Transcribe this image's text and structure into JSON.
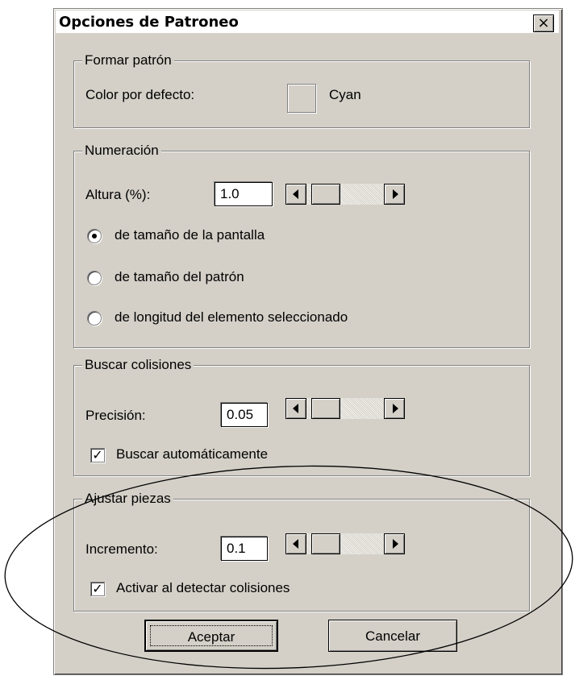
{
  "dialog": {
    "title": "Opciones de Patroneo",
    "close_label": "×"
  },
  "formar_patron": {
    "legend": "Formar patrón",
    "color_label": "Color por defecto:",
    "color_name": "Cyan",
    "swatch_color": "#d4d0c8"
  },
  "numeracion": {
    "legend": "Numeración",
    "altura_label": "Altura (%):",
    "altura_value": "1.0",
    "options": [
      {
        "label": "de tamaño de la pantalla",
        "selected": true
      },
      {
        "label": "de tamaño del patrón",
        "selected": false
      },
      {
        "label": "de longitud del elemento seleccionado",
        "selected": false
      }
    ]
  },
  "colisiones": {
    "legend": "Buscar colisiones",
    "precision_label": "Precisión:",
    "precision_value": "0.05",
    "auto_label": "Buscar automáticamente",
    "auto_checked": true
  },
  "ajustar": {
    "legend": "Ajustar piezas",
    "incremento_label": "Incremento:",
    "incremento_value": "0.1",
    "activar_label": "Activar al detectar colisiones",
    "activar_checked": true
  },
  "buttons": {
    "ok": "Aceptar",
    "cancel": "Cancelar"
  },
  "glyphs": {
    "check": "✓"
  }
}
